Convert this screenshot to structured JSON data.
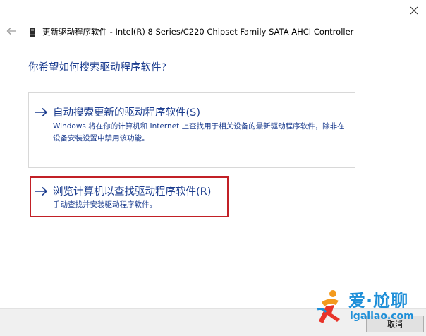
{
  "window": {
    "title": "更新驱动程序软件 - Intel(R) 8 Series/C220 Chipset Family SATA AHCI Controller"
  },
  "question": "你希望如何搜索驱动程序软件?",
  "options": [
    {
      "title": "自动搜索更新的驱动程序软件(S)",
      "description": "Windows 将在你的计算机和 Internet 上查找用于相关设备的最新驱动程序软件，除非在设备安装设置中禁用该功能。"
    },
    {
      "title": "浏览计算机以查找驱动程序软件(R)",
      "description": "手动查找并安装驱动程序软件。"
    }
  ],
  "footer": {
    "cancel_label": "取消"
  },
  "watermark": {
    "brand": "爱·尬聊",
    "url": "igaliao.com"
  },
  "colors": {
    "link": "#1c3d8f",
    "highlight": "#c22026",
    "watermark": "#1e8fd8"
  }
}
